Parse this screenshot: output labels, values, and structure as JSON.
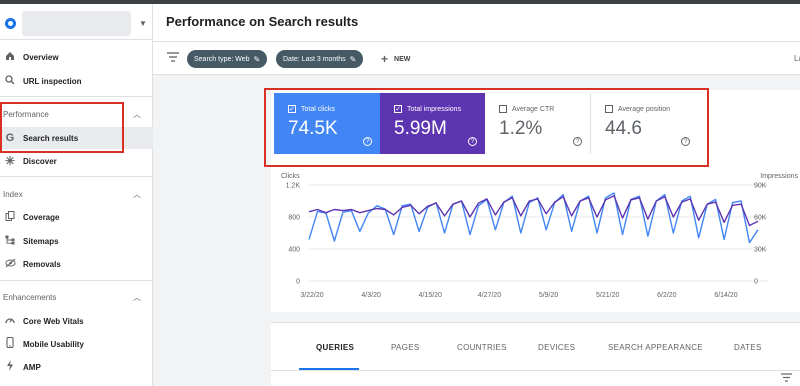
{
  "header": {
    "title": "Performance on Search results"
  },
  "sidebar": {
    "items": [
      {
        "label": "Overview",
        "icon": "home-icon"
      },
      {
        "label": "URL inspection",
        "icon": "search-icon"
      }
    ],
    "sections": [
      {
        "title": "Performance",
        "items": [
          {
            "label": "Search results",
            "icon": "google-g-icon"
          },
          {
            "label": "Discover",
            "icon": "asterisk-icon"
          }
        ]
      },
      {
        "title": "Index",
        "items": [
          {
            "label": "Coverage",
            "icon": "file-copy-icon"
          },
          {
            "label": "Sitemaps",
            "icon": "sitemap-icon"
          },
          {
            "label": "Removals",
            "icon": "eye-off-icon"
          }
        ]
      },
      {
        "title": "Enhancements",
        "items": [
          {
            "label": "Core Web Vitals",
            "icon": "speedometer-icon"
          },
          {
            "label": "Mobile Usability",
            "icon": "phone-icon"
          },
          {
            "label": "AMP",
            "icon": "bolt-icon"
          }
        ]
      }
    ]
  },
  "filters": {
    "search_type": "Search type: Web",
    "date": "Date: Last 3 months",
    "new_label": "NEW",
    "cutoff": "La"
  },
  "metrics": {
    "clicks": {
      "label": "Total clicks",
      "value": "74.5K",
      "checked": true
    },
    "impressions": {
      "label": "Total impressions",
      "value": "5.99M",
      "checked": true
    },
    "ctr": {
      "label": "Average CTR",
      "value": "1.2%",
      "checked": false
    },
    "position": {
      "label": "Average position",
      "value": "44.6",
      "checked": false
    }
  },
  "colors": {
    "clicks": "#4285f4",
    "impressions": "#5e35b1",
    "accent": "#1a73e8",
    "highlight": "#d93025"
  },
  "tabs": [
    "QUERIES",
    "PAGES",
    "COUNTRIES",
    "DEVICES",
    "SEARCH APPEARANCE",
    "DATES"
  ],
  "chart_data": {
    "type": "line",
    "y_left_label": "Clicks",
    "y_right_label": "Impressions",
    "y_left_ticks": [
      "1.2K",
      "800",
      "400",
      "0"
    ],
    "y_right_ticks": [
      "90K",
      "60K",
      "30K",
      "0"
    ],
    "ylim_left": [
      0,
      1200
    ],
    "ylim_right": [
      0,
      90000
    ],
    "x_ticks": [
      "3/22/20",
      "4/3/20",
      "4/15/20",
      "4/27/20",
      "5/9/20",
      "5/21/20",
      "6/2/20",
      "6/14/20"
    ],
    "grid": true,
    "series": [
      {
        "name": "Clicks",
        "axis": "left",
        "values": [
          520,
          870,
          850,
          500,
          860,
          880,
          620,
          850,
          940,
          900,
          580,
          940,
          960,
          620,
          920,
          980,
          600,
          960,
          1000,
          580,
          940,
          1020,
          640,
          980,
          1060,
          600,
          980,
          1040,
          640,
          980,
          1080,
          620,
          1000,
          1060,
          600,
          1040,
          1100,
          580,
          1020,
          1060,
          560,
          1000,
          1080,
          600,
          1000,
          1060,
          540,
          960,
          1020,
          520,
          980,
          1000,
          480,
          640
        ]
      },
      {
        "name": "Impressions",
        "axis": "right",
        "values": [
          65000,
          67000,
          64000,
          67000,
          66000,
          67000,
          64000,
          66000,
          68000,
          67000,
          62000,
          69000,
          71000,
          63000,
          70000,
          73000,
          61000,
          72000,
          75000,
          60000,
          73000,
          77000,
          62000,
          74000,
          78000,
          61000,
          75000,
          77000,
          63000,
          74000,
          79000,
          61000,
          75000,
          78000,
          60000,
          76000,
          80000,
          59000,
          76000,
          78000,
          58000,
          75000,
          79000,
          60000,
          74000,
          77000,
          57000,
          72000,
          74000,
          55000,
          71000,
          72000,
          52000,
          56000
        ]
      }
    ]
  }
}
